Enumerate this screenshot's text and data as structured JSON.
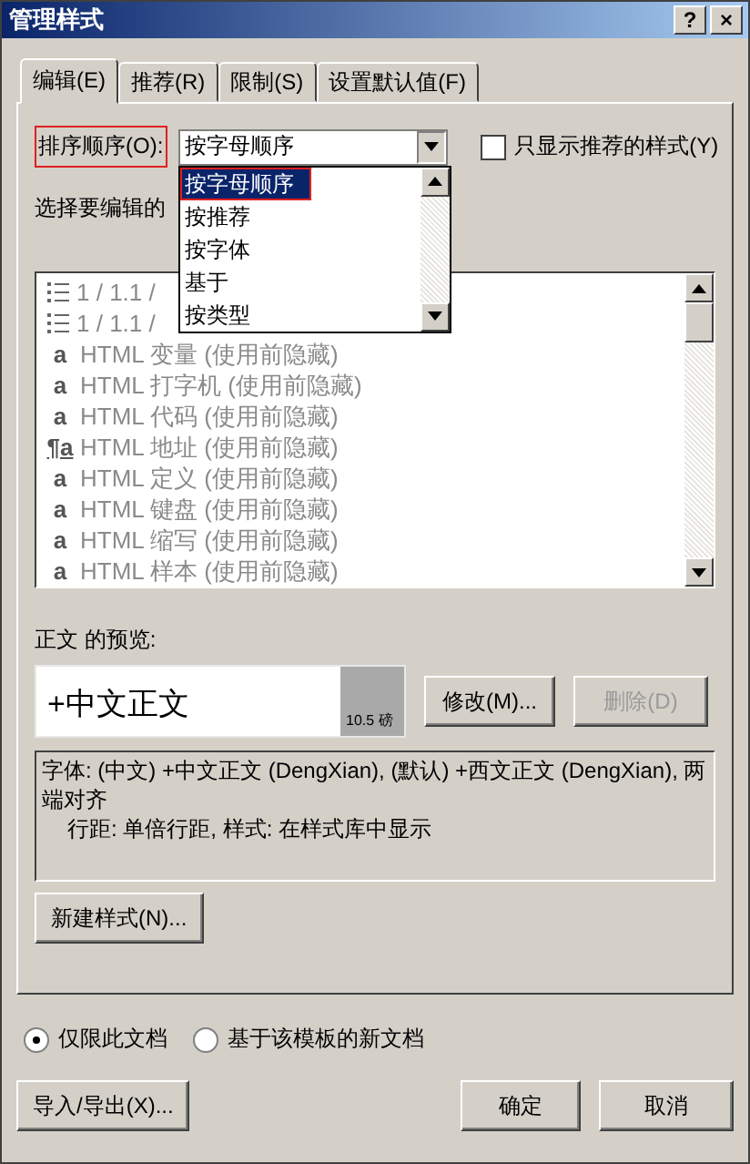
{
  "window": {
    "title": "管理样式",
    "help_button": "?",
    "close_button": "×"
  },
  "tabs": [
    {
      "label": "编辑(E)",
      "selected": true
    },
    {
      "label": "推荐(R)",
      "selected": false
    },
    {
      "label": "限制(S)",
      "selected": false
    },
    {
      "label": "设置默认值(F)",
      "selected": false
    }
  ],
  "sort": {
    "label": "排序顺序(O):",
    "highlighted": true,
    "value": "按字母顺序",
    "expanded": true,
    "options": [
      {
        "label": "按字母顺序",
        "selected": true,
        "highlighted": true
      },
      {
        "label": "按推荐",
        "selected": false,
        "highlighted": false
      },
      {
        "label": "按字体",
        "selected": false,
        "highlighted": false
      },
      {
        "label": "基于",
        "selected": false,
        "highlighted": false
      },
      {
        "label": "按类型",
        "selected": false,
        "highlighted": false
      }
    ]
  },
  "recommended_only": {
    "label": "只显示推荐的样式(Y)",
    "checked": false
  },
  "styles_label": "选择要编辑的",
  "styles": [
    {
      "kind": "numbered",
      "label": "1 / 1.1 /",
      "hidden": true
    },
    {
      "kind": "numbered",
      "label": "1 / 1.1 /",
      "hidden": true
    },
    {
      "kind": "character",
      "icon": "a",
      "label": "HTML 变量  (使用前隐藏)",
      "hidden": true
    },
    {
      "kind": "character",
      "icon": "a",
      "label": "HTML 打字机  (使用前隐藏)",
      "hidden": true
    },
    {
      "kind": "character",
      "icon": "a",
      "label": "HTML 代码  (使用前隐藏)",
      "hidden": true
    },
    {
      "kind": "linked",
      "icon": "¶a",
      "label": "HTML 地址  (使用前隐藏)",
      "hidden": true
    },
    {
      "kind": "character",
      "icon": "a",
      "label": "HTML 定义  (使用前隐藏)",
      "hidden": true
    },
    {
      "kind": "character",
      "icon": "a",
      "label": "HTML 键盘  (使用前隐藏)",
      "hidden": true
    },
    {
      "kind": "character",
      "icon": "a",
      "label": "HTML 缩写  (使用前隐藏)",
      "hidden": true
    },
    {
      "kind": "character",
      "icon": "a",
      "label": "HTML 样本  (使用前隐藏)",
      "hidden": true
    }
  ],
  "preview": {
    "label": "正文 的预览:",
    "sample": "+中文正文",
    "size": "10.5 磅"
  },
  "modify_button": {
    "label": "修改(M)...",
    "disabled": false
  },
  "delete_button": {
    "label": "删除(D)",
    "disabled": true
  },
  "description": [
    "字体: (中文) +中文正文 (DengXian), (默认) +西文正文 (DengXian), 两端对齐",
    "行距: 单倍行距, 样式: 在样式库中显示"
  ],
  "new_style_button": "新建样式(N)...",
  "scope": [
    {
      "label": "仅限此文档",
      "selected": true
    },
    {
      "label": "基于该模板的新文档",
      "selected": false
    }
  ],
  "import_export_button": "导入/导出(X)...",
  "ok_button": "确定",
  "cancel_button": "取消"
}
